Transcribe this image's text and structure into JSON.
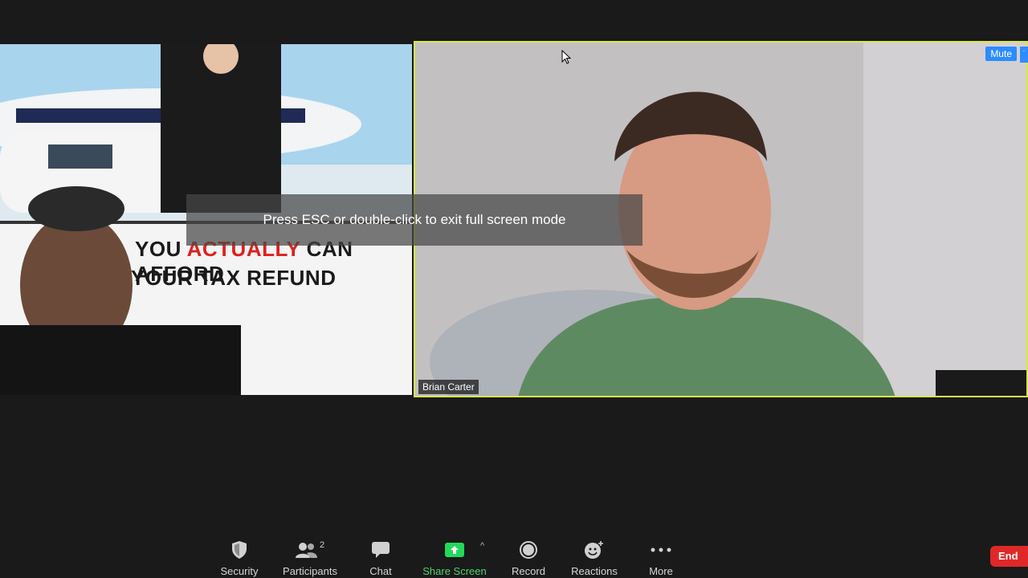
{
  "toast": {
    "text": "Press ESC or double-click to exit full screen mode"
  },
  "participants_tiles": {
    "active_speaker_name": "Brian Carter",
    "mute_label": "Mute",
    "more_label": "···"
  },
  "left_tile_banner": {
    "line1_a": "YOU",
    "line1_b": "ACTUALLY",
    "line1_c": "CAN AFFORD",
    "line2": "YOUR TAX REFUND"
  },
  "toolbar": {
    "security": "Security",
    "participants": "Participants",
    "participants_count": "2",
    "chat": "Chat",
    "share_screen": "Share Screen",
    "share_caret": "^",
    "record": "Record",
    "reactions": "Reactions",
    "more": "More",
    "end": "End"
  },
  "colors": {
    "active_speaker_border": "#d8e84a",
    "share_green": "#23d959",
    "end_red": "#e02828",
    "mute_blue": "#2d8cff"
  }
}
